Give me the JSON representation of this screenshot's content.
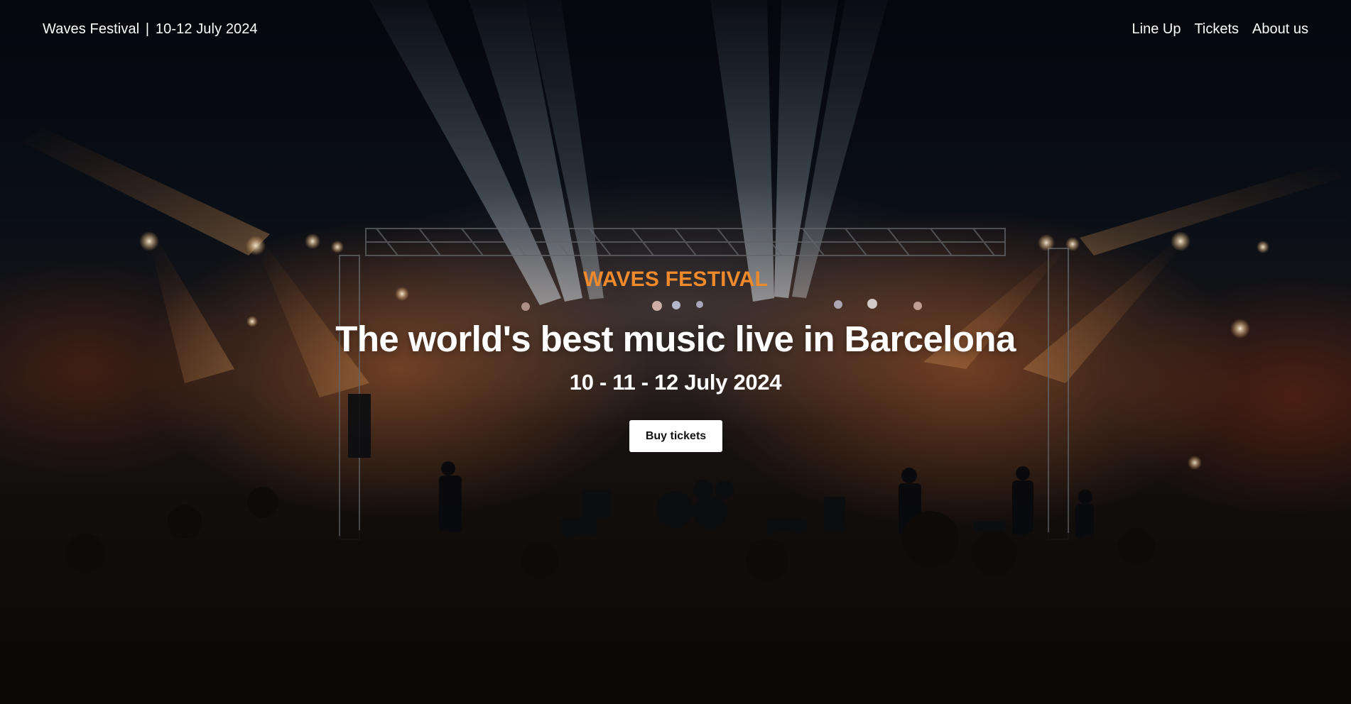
{
  "header": {
    "brand_name": "Waves Festival",
    "brand_separator": "|",
    "brand_dates": "10-12 July 2024",
    "nav": [
      {
        "label": "Line Up"
      },
      {
        "label": "Tickets"
      },
      {
        "label": "About us"
      }
    ]
  },
  "hero": {
    "eyebrow": "WAVES FESTIVAL",
    "headline": "The world's best music live in Barcelona",
    "dates": "10 - 11 - 12 July 2024",
    "cta_label": "Buy tickets",
    "background_image": "concert-stage-photo"
  },
  "colors": {
    "accent": "#ee8a2c",
    "text": "#ffffff",
    "button_bg": "#ffffff",
    "button_text": "#111111",
    "background": "#05080d"
  }
}
